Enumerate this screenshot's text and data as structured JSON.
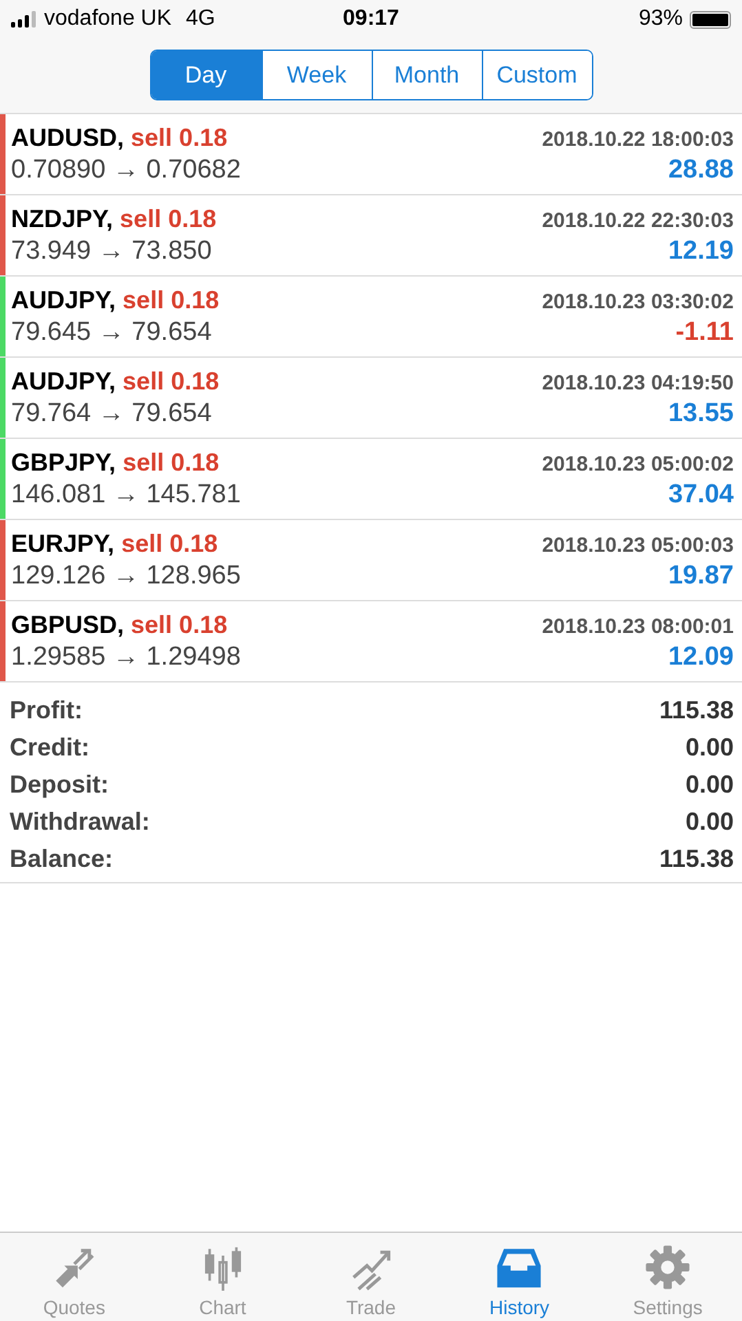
{
  "status_bar": {
    "carrier": "vodafone UK",
    "network": "4G",
    "time": "09:17",
    "battery": "93%"
  },
  "tabs": [
    {
      "label": "Day",
      "selected": true
    },
    {
      "label": "Week",
      "selected": false
    },
    {
      "label": "Month",
      "selected": false
    },
    {
      "label": "Custom",
      "selected": false
    }
  ],
  "deals": [
    {
      "symbol": "AUDUSD,",
      "action": "sell 0.18",
      "time": "2018.10.22 18:00:03",
      "prices": "0.70890 → 0.70682",
      "profit": "28.88",
      "loss": false,
      "color": "#e0574a"
    },
    {
      "symbol": "NZDJPY,",
      "action": "sell 0.18",
      "time": "2018.10.22 22:30:03",
      "prices": "73.949 → 73.850",
      "profit": "12.19",
      "loss": false,
      "color": "#e0574a"
    },
    {
      "symbol": "AUDJPY,",
      "action": "sell 0.18",
      "time": "2018.10.23 03:30:02",
      "prices": "79.645 → 79.654",
      "profit": "-1.11",
      "loss": true,
      "color": "#4cd964"
    },
    {
      "symbol": "AUDJPY,",
      "action": "sell 0.18",
      "time": "2018.10.23 04:19:50",
      "prices": "79.764 → 79.654",
      "profit": "13.55",
      "loss": false,
      "color": "#4cd964"
    },
    {
      "symbol": "GBPJPY,",
      "action": "sell 0.18",
      "time": "2018.10.23 05:00:02",
      "prices": "146.081 → 145.781",
      "profit": "37.04",
      "loss": false,
      "color": "#4cd964"
    },
    {
      "symbol": "EURJPY,",
      "action": "sell 0.18",
      "time": "2018.10.23 05:00:03",
      "prices": "129.126 → 128.965",
      "profit": "19.87",
      "loss": false,
      "color": "#e0574a"
    },
    {
      "symbol": "GBPUSD,",
      "action": "sell 0.18",
      "time": "2018.10.23 08:00:01",
      "prices": "1.29585 → 1.29498",
      "profit": "12.09",
      "loss": false,
      "color": "#e0574a"
    }
  ],
  "summary": [
    {
      "label": "Profit:",
      "value": "115.38"
    },
    {
      "label": "Credit:",
      "value": "0.00"
    },
    {
      "label": "Deposit:",
      "value": "0.00"
    },
    {
      "label": "Withdrawal:",
      "value": "0.00"
    },
    {
      "label": "Balance:",
      "value": "115.38"
    }
  ],
  "tab_bar": [
    {
      "label": "Quotes",
      "kind": "quotes",
      "selected": false
    },
    {
      "label": "Chart",
      "kind": "chart",
      "selected": false
    },
    {
      "label": "Trade",
      "kind": "trade",
      "selected": false
    },
    {
      "label": "History",
      "kind": "history",
      "selected": true
    },
    {
      "label": "Settings",
      "kind": "settings",
      "selected": false
    }
  ]
}
